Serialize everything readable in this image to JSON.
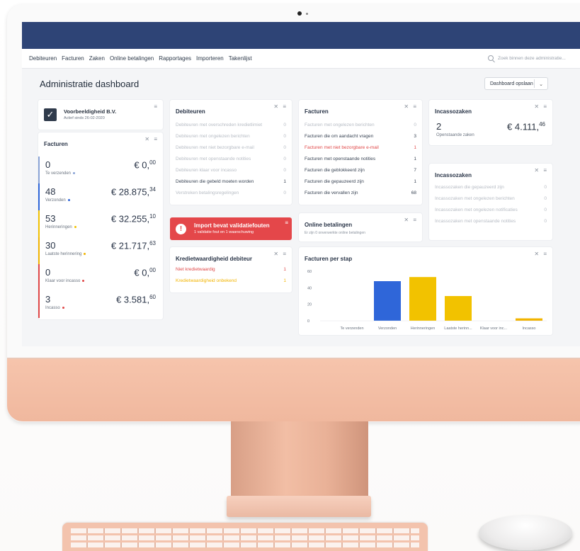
{
  "nav": [
    "Debiteuren",
    "Facturen",
    "Zaken",
    "Online betalingen",
    "Rapportages",
    "Importeren",
    "Takenlijst"
  ],
  "search_placeholder": "Zoek binnen deze administratie...",
  "page_title": "Administratie dashboard",
  "save_button": "Dashboard opslaan",
  "company": {
    "name": "Voorbeeldigheid B.V.",
    "since": "Actief sinds 26-02-2020"
  },
  "facturen_kpi": {
    "title": "Facturen",
    "items": [
      {
        "count": "0",
        "label": "Te verzenden",
        "amount": "€ 0,",
        "cents": "00",
        "color": "#8aa3d6"
      },
      {
        "count": "48",
        "label": "Verzonden",
        "amount": "€ 28.875,",
        "cents": "34",
        "color": "#2f66d9"
      },
      {
        "count": "53",
        "label": "Herinneringen",
        "amount": "€ 32.255,",
        "cents": "10",
        "color": "#f2c200"
      },
      {
        "count": "30",
        "label": "Laatste herinnering",
        "amount": "€ 21.717,",
        "cents": "63",
        "color": "#f2b400"
      },
      {
        "count": "0",
        "label": "Klaar voor incasso",
        "amount": "€ 0,",
        "cents": "00",
        "color": "#e04848"
      },
      {
        "count": "3",
        "label": "Incasso",
        "amount": "€ 3.581,",
        "cents": "60",
        "color": "#e04848"
      }
    ]
  },
  "debiteuren": {
    "title": "Debiteuren",
    "rows": [
      {
        "label": "Debiteuren met overschreden kredietlimiet",
        "count": "0",
        "style": "muted"
      },
      {
        "label": "Debiteuren met ongelezen berichten",
        "count": "0",
        "style": "muted"
      },
      {
        "label": "Debiteuren met niet bezorgbare e-mail",
        "count": "0",
        "style": "muted"
      },
      {
        "label": "Debiteuren met openstaande notities",
        "count": "0",
        "style": "muted"
      },
      {
        "label": "Debiteuren klaar voor incasso",
        "count": "0",
        "style": "muted"
      },
      {
        "label": "Debiteuren die gebeld moeten worden",
        "count": "1",
        "style": "dark"
      },
      {
        "label": "Verstreken betalingsregelingen",
        "count": "0",
        "style": "muted"
      }
    ]
  },
  "facturen_list": {
    "title": "Facturen",
    "rows": [
      {
        "label": "Facturen met ongelezen berichten",
        "count": "0",
        "style": "muted"
      },
      {
        "label": "Facturen die om aandacht vragen",
        "count": "3",
        "style": "dark"
      },
      {
        "label": "Facturen met niet bezorgbare e-mail",
        "count": "1",
        "style": "red"
      },
      {
        "label": "Facturen met openstaande notities",
        "count": "1",
        "style": "dark"
      },
      {
        "label": "Facturen die geblokkeerd zijn",
        "count": "7",
        "style": "dark"
      },
      {
        "label": "Facturen die gepauzeerd zijn",
        "count": "1",
        "style": "dark"
      },
      {
        "label": "Facturen die vervallen zijn",
        "count": "68",
        "style": "dark"
      }
    ]
  },
  "incasso_summary": {
    "title": "Incassozaken",
    "count": "2",
    "count_label": "Openstaande zaken",
    "amount": "€ 4.111,",
    "cents": "46"
  },
  "incasso_list": {
    "title": "Incassozaken",
    "rows": [
      {
        "label": "Incassozaken die gepauzeerd zijn",
        "count": "0"
      },
      {
        "label": "Incassozaken met ongelezen berichten",
        "count": "0"
      },
      {
        "label": "Incassozaken met ongelezen notificaties",
        "count": "0"
      },
      {
        "label": "Incassozaken met openstaande notities",
        "count": "0"
      }
    ]
  },
  "alert": {
    "title": "Import bevat validatiefouten",
    "subtitle": "1 validatie fout en 1 waarschuwing"
  },
  "online": {
    "title": "Online betalingen",
    "subtitle": "Er zijn 0 onverwerkte online betalingen"
  },
  "krediet": {
    "title": "Kredietwaardigheid debiteur",
    "rows": [
      {
        "label": "Niet kredietwaardig",
        "count": "1",
        "style": "red"
      },
      {
        "label": "Kredietwaardigheid onbekend",
        "count": "1",
        "style": "amber"
      }
    ]
  },
  "chart_data": {
    "type": "bar",
    "title": "Facturen per stap",
    "categories": [
      "Te verzenden",
      "Verzonden",
      "Herinneringen",
      "Laatste herinn...",
      "Klaar voor inc...",
      "Incasso"
    ],
    "values": [
      0,
      48,
      53,
      30,
      0,
      3
    ],
    "colors": [
      "#2f66d9",
      "#2f66d9",
      "#f2c200",
      "#f2c200",
      "#f2b400",
      "#f2b400"
    ],
    "ylim": [
      0,
      60
    ],
    "yticks": [
      "0",
      "20",
      "40",
      "60"
    ]
  }
}
